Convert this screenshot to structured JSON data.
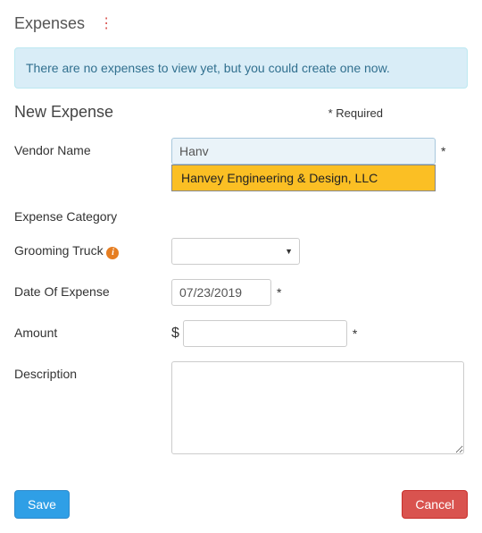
{
  "header": {
    "title": "Expenses"
  },
  "alert": {
    "message": "There are no expenses to view yet, but you could create one now."
  },
  "section": {
    "title": "New Expense",
    "required_note": "* Required"
  },
  "form": {
    "vendor": {
      "label": "Vendor Name",
      "value": "Hanv",
      "asterisk": "*",
      "suggestion": "Hanvey Engineering & Design, LLC"
    },
    "category": {
      "label": "Expense Category"
    },
    "truck": {
      "label": "Grooming Truck",
      "selected": ""
    },
    "date": {
      "label": "Date Of Expense",
      "value": "07/23/2019",
      "asterisk": "*"
    },
    "amount": {
      "label": "Amount",
      "prefix": "$",
      "value": "",
      "asterisk": "*"
    },
    "description": {
      "label": "Description",
      "value": ""
    }
  },
  "buttons": {
    "save": "Save",
    "cancel": "Cancel"
  }
}
